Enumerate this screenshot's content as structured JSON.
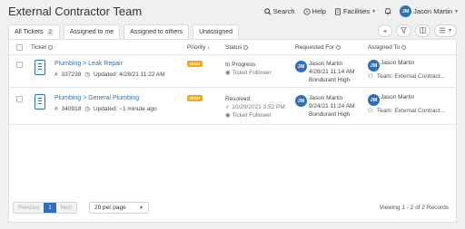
{
  "header": {
    "title": "External Contractor Team",
    "search": "Search",
    "help": "Help",
    "facilities": "Facilities",
    "user_initials": "JM",
    "user_name": "Jason Martin"
  },
  "tabs": [
    {
      "label": "All Tickets",
      "count": "2"
    },
    {
      "label": "Assigned to me"
    },
    {
      "label": "Assigned to others"
    },
    {
      "label": "Unassigned"
    }
  ],
  "columns": {
    "ticket": "Ticket",
    "priority": "Priority",
    "status": "Status",
    "requested_for": "Requested For",
    "assigned_to": "Assigned To"
  },
  "rows": [
    {
      "title": "Plumbing > Leak Repair",
      "id": "337238",
      "updated": "Updated: 4/28/21 11:22 AM",
      "priority": "HIGH",
      "status": "In Progress",
      "status_sub": "Ticket Follower",
      "req_initials": "JM",
      "req_name": "Jason Martin",
      "req_date": "4/28/21 11:14 AM",
      "req_site": "Bondurant High",
      "assignee_initials": "JM",
      "assignee": "Jason Martin",
      "team": "Team: External Contract..."
    },
    {
      "title": "Plumbing > General Plumbing",
      "id": "340918",
      "updated": "Updated: ~1 minute ago",
      "priority": "HIGH",
      "status": "Resolved",
      "status_date": "10/29/2021 3:52 PM",
      "status_sub": "Ticket Follower",
      "req_initials": "JM",
      "req_name": "Jason Martin",
      "req_date": "9/24/21 11:24 AM",
      "req_site": "Bondurant High",
      "assignee_initials": "JM",
      "assignee": "Jason Martin",
      "team": "Team: External Contract..."
    }
  ],
  "footer": {
    "prev": "Previous",
    "page": "1",
    "next": "Next",
    "per_page": "20 per page",
    "viewing": "Viewing 1 - 2 of 2 Records"
  },
  "colors": {
    "accent": "#2e6fb8",
    "priority_high": "#f2a81c"
  }
}
